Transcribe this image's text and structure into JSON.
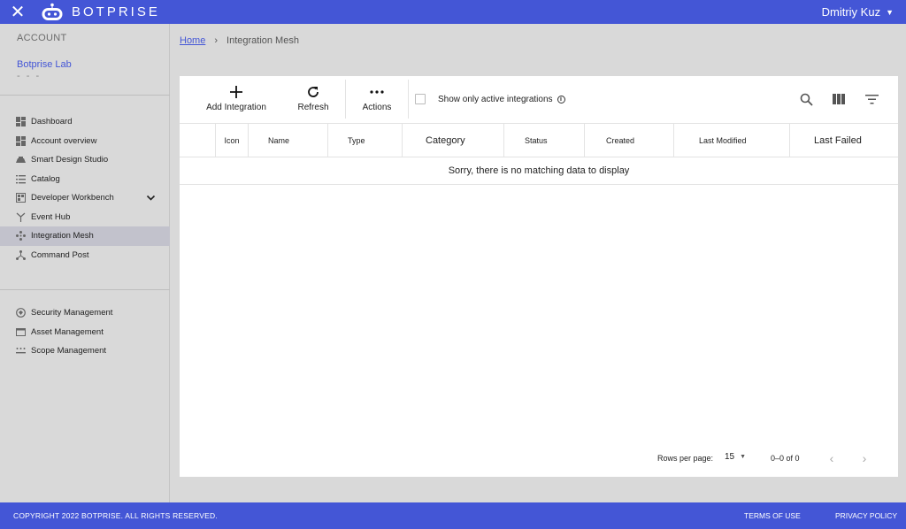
{
  "header": {
    "brand": "BOTPRISE",
    "user_name": "Dmitriy Kuz",
    "close_icon": "close-icon",
    "brand_color": "#4456d6"
  },
  "sidebar": {
    "account_label": "ACCOUNT",
    "org_name": "Botprise Lab",
    "org_sub": "- - -",
    "items": [
      {
        "label": "Dashboard",
        "icon": "dashboard-icon"
      },
      {
        "label": "Account overview",
        "icon": "account-overview-icon"
      },
      {
        "label": "Smart Design Studio",
        "icon": "smart-design-icon"
      },
      {
        "label": "Catalog",
        "icon": "catalog-icon"
      },
      {
        "label": "Developer Workbench",
        "icon": "workbench-icon"
      },
      {
        "label": "Event Hub",
        "icon": "event-hub-icon"
      },
      {
        "label": "Integration Mesh",
        "icon": "integration-mesh-icon",
        "active": true
      },
      {
        "label": "Command Post",
        "icon": "command-post-icon"
      }
    ],
    "items2": [
      {
        "label": "Security Management",
        "icon": "security-icon"
      },
      {
        "label": "Asset Management",
        "icon": "asset-icon"
      },
      {
        "label": "Scope Management",
        "icon": "scope-icon"
      }
    ]
  },
  "breadcrumb": {
    "home": "Home",
    "current": "Integration Mesh"
  },
  "toolbar": {
    "add_label": "Add Integration",
    "refresh_label": "Refresh",
    "actions_label": "Actions",
    "active_filter_label": "Show only active integrations",
    "active_filter_checked": false
  },
  "table": {
    "columns": [
      "Icon",
      "Name",
      "Type",
      "Category",
      "Status",
      "Created",
      "Last Modified",
      "Last Failed"
    ],
    "empty_message": "Sorry, there is no matching data to display"
  },
  "pagination": {
    "rows_per_page_label": "Rows per page:",
    "rows_per_page": "15",
    "range": "0–0 of 0"
  },
  "footer": {
    "copyright": "COPYRIGHT 2022 BOTPRISE. ALL RIGHTS RESERVED.",
    "terms": "TERMS OF USE",
    "privacy": "PRIVACY POLICY"
  }
}
